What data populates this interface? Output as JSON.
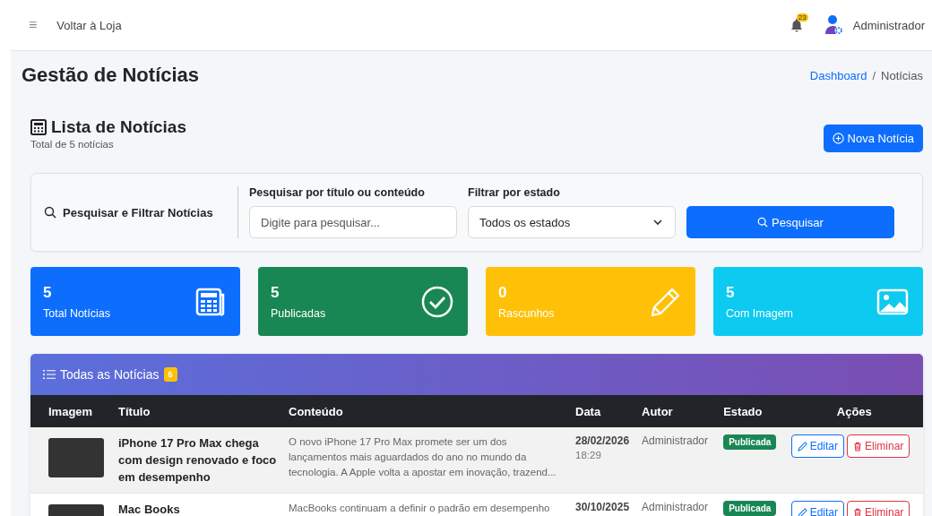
{
  "topbar": {
    "menu_icon": "≡",
    "back_link": "Voltar à Loja",
    "notification_count": "23",
    "user": "Administrador"
  },
  "page": {
    "title": "Gestão de Notícias",
    "breadcrumb_separator": "/",
    "breadcrumb": [
      {
        "label": "Dashboard",
        "selected": false
      },
      {
        "label": "Notícias",
        "selected": true
      }
    ]
  },
  "list_header": {
    "title": "Lista de Notícias",
    "subtitle": "Total de 5 notícias",
    "new_button": "Nova Notícia"
  },
  "filters": {
    "title": "Pesquisar e Filtrar Notícias",
    "search_label": "Pesquisar por título ou conteúdo",
    "search_placeholder": "Digite para pesquisar...",
    "status_label": "Filtrar por estado",
    "status_value": "Todos os estados",
    "search_button": "Pesquisar"
  },
  "stats": [
    {
      "kind": "total",
      "value": "5",
      "label": "Total Notícias",
      "color": "#0d6efd"
    },
    {
      "kind": "published",
      "value": "5",
      "label": "Publicadas",
      "color": "#198754"
    },
    {
      "kind": "draft",
      "value": "0",
      "label": "Rascunhos",
      "color": "#ffc107"
    },
    {
      "kind": "image",
      "value": "5",
      "label": "Com Imagem",
      "color": "#0dcaf0"
    }
  ],
  "table": {
    "title": "Todas as Notícias",
    "count": "5",
    "columns": [
      "Imagem",
      "Título",
      "Conteúdo",
      "Data",
      "Autor",
      "Estado",
      "Ações"
    ],
    "rows": [
      {
        "title": "iPhone 17 Pro Max chega com design renovado e foco em desempenho",
        "content": "O novo iPhone 17 Pro Max promete ser um dos lançamentos mais aguardados do ano no mundo da tecnologia. A Apple volta a apostar em inovação, trazend...",
        "date": "28/02/2026",
        "time": "18:29",
        "author": "Administrador",
        "status": {
          "kind": "published",
          "label": "Publicada"
        },
        "edit": "Editar",
        "delete": "Eliminar"
      },
      {
        "title": "Mac Books",
        "content": "MacBooks continuam a definir o padrão em desempenho",
        "date": "30/10/2025",
        "time": "",
        "author": "Administrador",
        "status": {
          "kind": "published",
          "label": "Publicada"
        },
        "edit": "Editar",
        "delete": "Eliminar"
      }
    ]
  }
}
